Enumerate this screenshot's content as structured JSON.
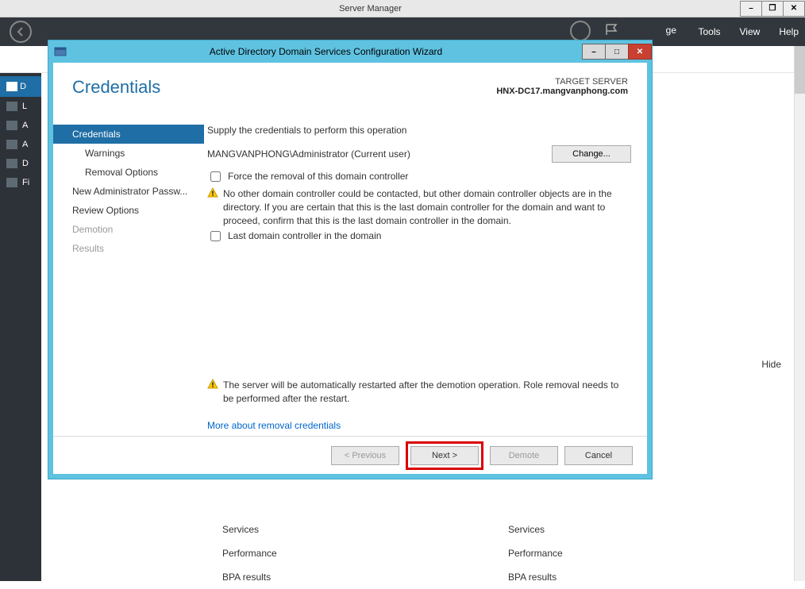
{
  "outer": {
    "title": "Server Manager",
    "menu": {
      "ge": "ge",
      "tools": "Tools",
      "view": "View",
      "help": "Help"
    }
  },
  "sm_sidebar": {
    "dash": "D",
    "items": [
      "L",
      "A",
      "A",
      "D",
      "Fi"
    ]
  },
  "hide": "Hide",
  "service_rows": {
    "r1": "Services",
    "r2": "Performance",
    "r3": "BPA results"
  },
  "wizard": {
    "title": "Active Directory Domain Services Configuration Wizard",
    "heading": "Credentials",
    "target_label": "TARGET SERVER",
    "target_value": "HNX-DC17.mangvanphong.com",
    "nav": {
      "credentials": "Credentials",
      "warnings": "Warnings",
      "removal": "Removal Options",
      "new_admin": "New Administrator Passw...",
      "review": "Review Options",
      "demotion": "Demotion",
      "results": "Results"
    },
    "content": {
      "supply": "Supply the credentials to perform this operation",
      "current_user": "MANGVANPHONG\\Administrator (Current user)",
      "change": "Change...",
      "force_removal": "Force the removal of this domain controller",
      "warn1": "No other domain controller could be contacted, but other domain controller objects are in the directory.  If you are certain that this is the last domain controller for the domain and want to proceed, confirm that this is the last domain controller in the domain.",
      "last_dc": "Last domain controller in the domain",
      "footer_warn": "The server will be automatically restarted after the demotion operation. Role removal needs to be performed after the restart.",
      "more_link": "More about removal credentials"
    },
    "buttons": {
      "previous": "< Previous",
      "next": "Next >",
      "demote": "Demote",
      "cancel": "Cancel"
    }
  }
}
